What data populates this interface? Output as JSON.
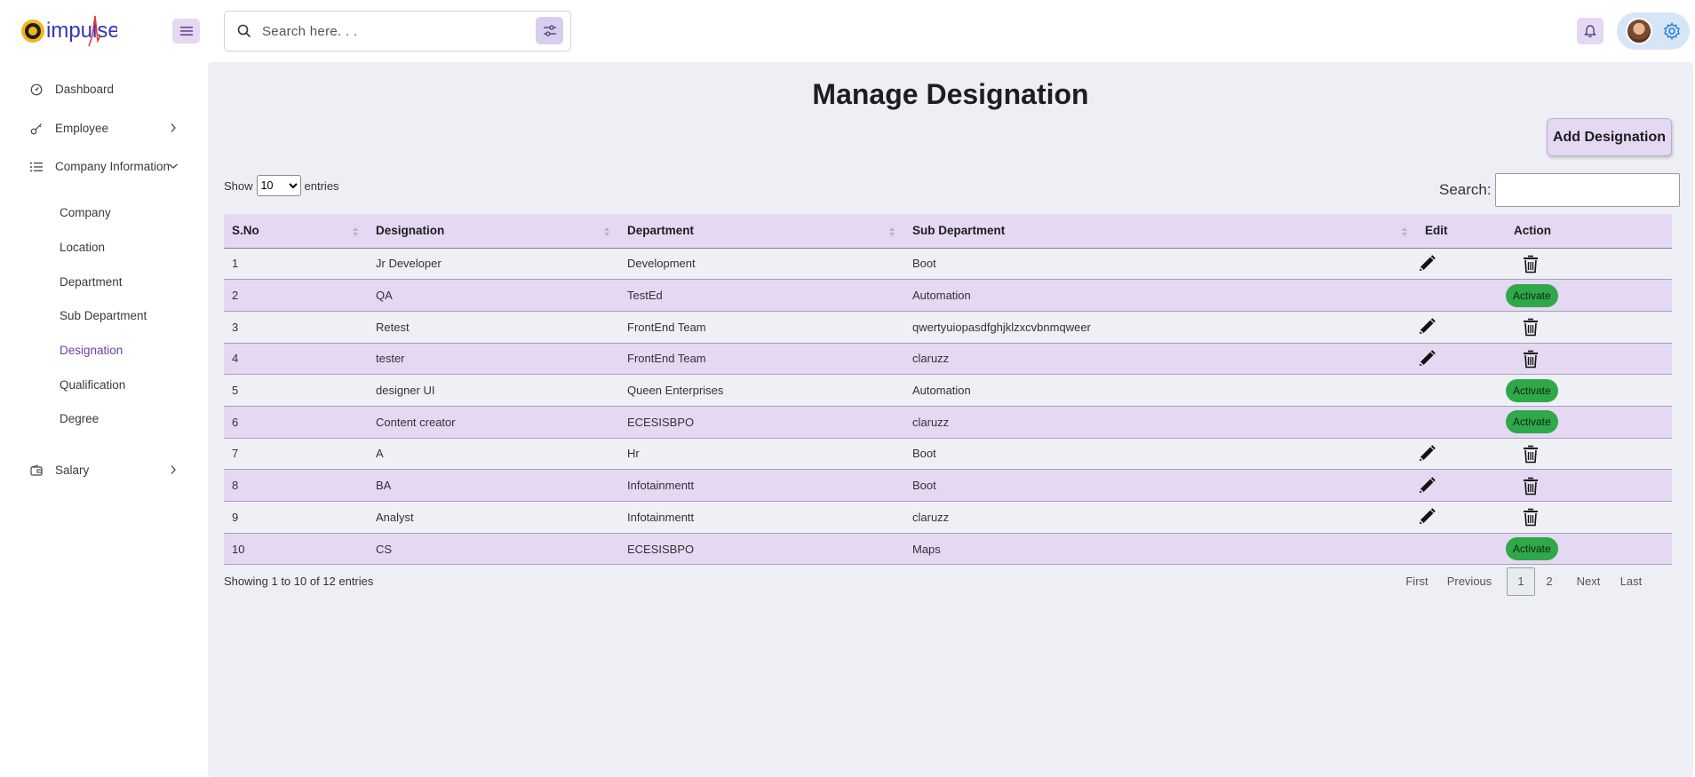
{
  "brand": {
    "logo_text": "impulse"
  },
  "search": {
    "placeholder": "Search here. . ."
  },
  "sidebar": {
    "items": [
      {
        "label": "Dashboard"
      },
      {
        "label": "Employee"
      },
      {
        "label": "Company Information"
      },
      {
        "label": "Salary"
      }
    ],
    "sub_items": [
      {
        "label": "Company"
      },
      {
        "label": "Location"
      },
      {
        "label": "Department"
      },
      {
        "label": "Sub Department"
      },
      {
        "label": "Designation",
        "active": true
      },
      {
        "label": "Qualification"
      },
      {
        "label": "Degree"
      }
    ]
  },
  "page": {
    "title": "Manage Designation",
    "add_button": "Add Designation",
    "show_label": "Show",
    "entries_label": "entries",
    "page_size": "10",
    "search_label": "Search:",
    "info": "Showing 1 to 10 of 12 entries"
  },
  "table": {
    "headers": [
      "S.No",
      "Designation",
      "Department",
      "Sub Department",
      "Edit",
      "Action"
    ],
    "rows": [
      {
        "sno": "1",
        "designation": "Jr Developer",
        "department": "Development",
        "sub_department": "Boot",
        "status": "active"
      },
      {
        "sno": "2",
        "designation": "QA",
        "department": "TestEd",
        "sub_department": "Automation",
        "status": "inactive"
      },
      {
        "sno": "3",
        "designation": "Retest",
        "department": "FrontEnd Team",
        "sub_department": "qwertyuiopasdfghjklzxcvbnmqweer",
        "status": "active"
      },
      {
        "sno": "4",
        "designation": "tester",
        "department": "FrontEnd Team",
        "sub_department": "claruzz",
        "status": "active"
      },
      {
        "sno": "5",
        "designation": "designer UI",
        "department": "Queen Enterprises",
        "sub_department": "Automation",
        "status": "inactive"
      },
      {
        "sno": "6",
        "designation": "Content creator",
        "department": "ECESISBPO",
        "sub_department": "claruzz",
        "status": "inactive"
      },
      {
        "sno": "7",
        "designation": "A",
        "department": "Hr",
        "sub_department": "Boot",
        "status": "active"
      },
      {
        "sno": "8",
        "designation": "BA",
        "department": "Infotainmentt",
        "sub_department": "Boot",
        "status": "active"
      },
      {
        "sno": "9",
        "designation": "Analyst",
        "department": "Infotainmentt",
        "sub_department": "claruzz",
        "status": "active"
      },
      {
        "sno": "10",
        "designation": "CS",
        "department": "ECESISBPO",
        "sub_department": "Maps",
        "status": "inactive"
      }
    ],
    "activate_label": "Activate"
  },
  "pagination": {
    "first": "First",
    "previous": "Previous",
    "pages": [
      "1",
      "2"
    ],
    "current_page": "1",
    "next": "Next",
    "last": "Last"
  },
  "colors": {
    "accent": "#e4d8f2",
    "activate": "#2fa84a",
    "active_link": "#6b3fa8",
    "background": "#edeff4"
  }
}
